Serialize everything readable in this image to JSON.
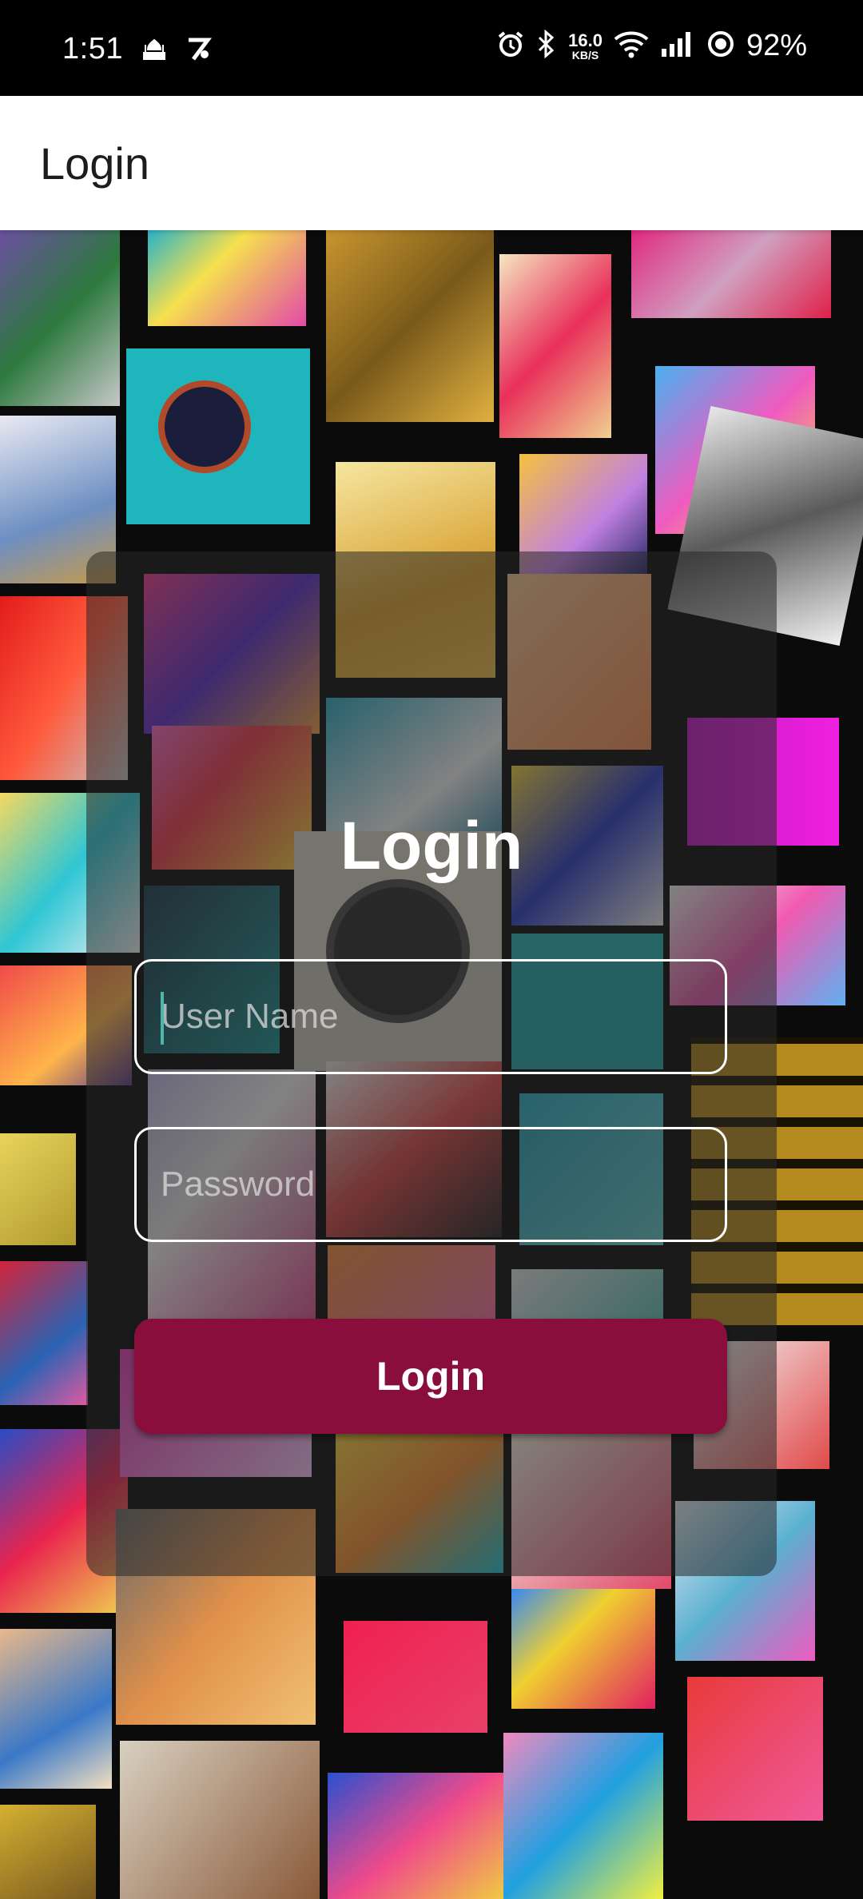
{
  "status_bar": {
    "time": "1:51",
    "network_speed": "16.0",
    "network_speed_unit": "KB/S",
    "battery": "92%",
    "icons": [
      "mosque-icon",
      "app-z-icon",
      "alarm-icon",
      "bluetooth-icon",
      "wifi-icon",
      "signal-icon",
      "battery-ring-icon"
    ]
  },
  "app_bar": {
    "title": "Login"
  },
  "login": {
    "title": "Login",
    "username_placeholder": "User Name",
    "username_value": "",
    "password_placeholder": "Password",
    "password_value": "",
    "button_label": "Login"
  },
  "colors": {
    "accent_button": "#8a0e3c",
    "cursor": "#4db6ac",
    "app_bar_bg": "#ffffff",
    "status_bar_bg": "#000000"
  }
}
